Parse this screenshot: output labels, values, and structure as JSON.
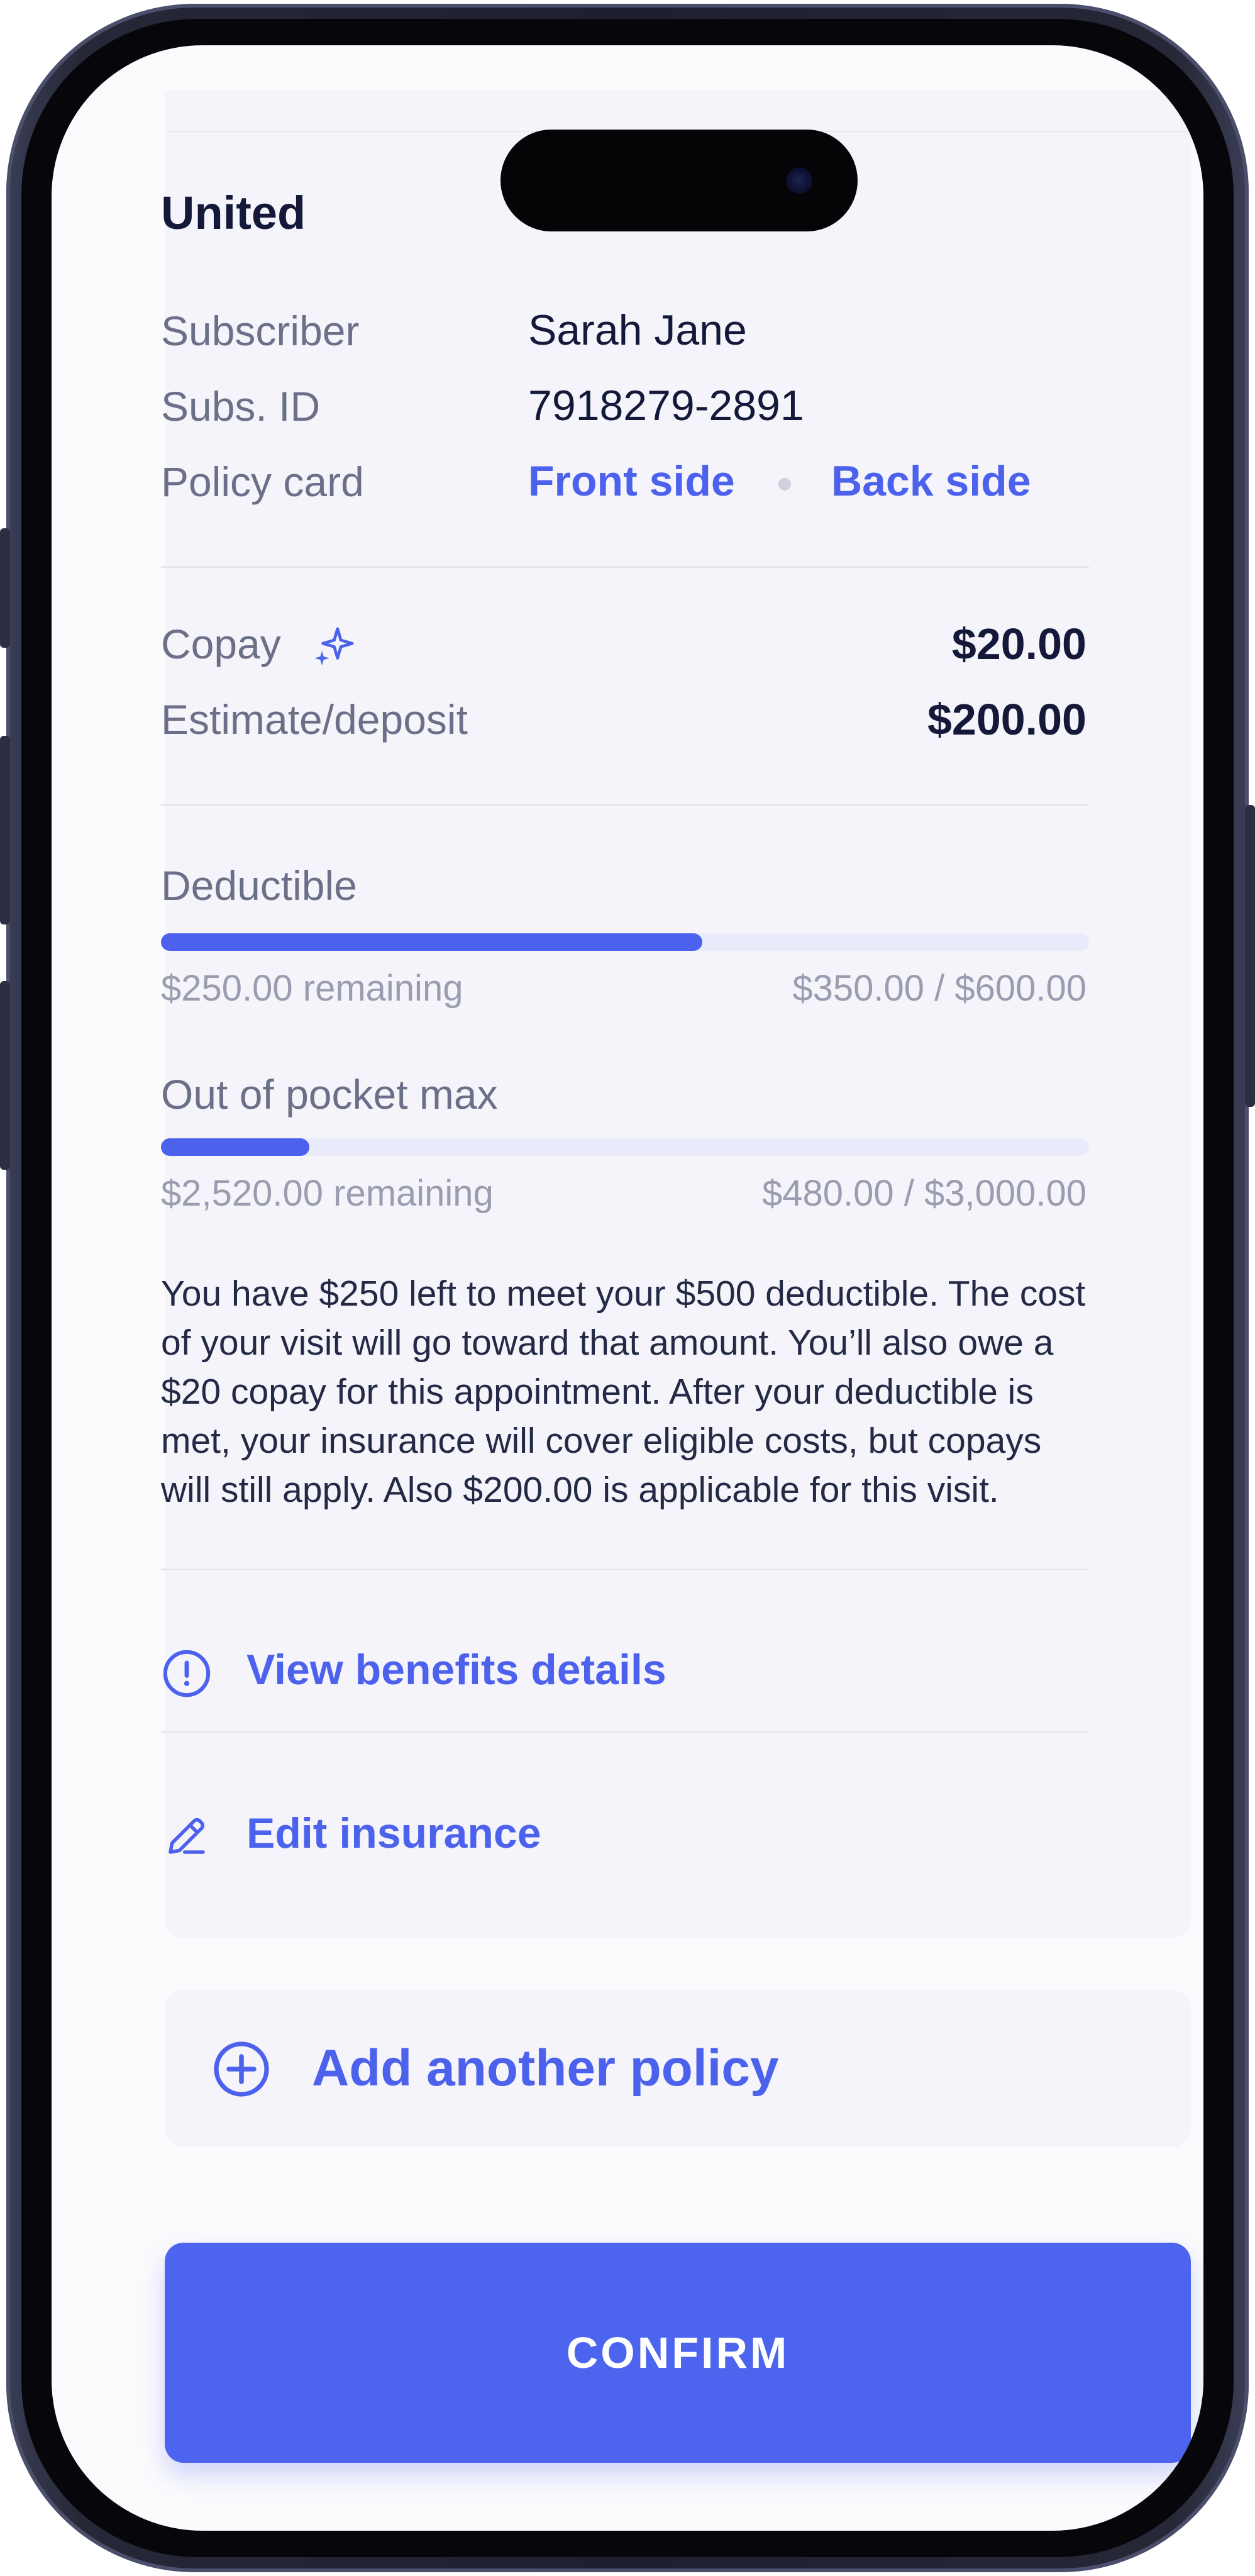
{
  "insurance": {
    "provider_name": "United",
    "subscriber_label": "Subscriber",
    "subscriber_value": "Sarah Jane",
    "subs_id_label": "Subs. ID",
    "subs_id_value": "7918279-2891",
    "policy_card_label": "Policy card",
    "front_side_label": "Front side",
    "back_side_label": "Back side",
    "copay_label": "Copay",
    "copay_value": "$20.00",
    "estimate_label": "Estimate/deposit",
    "estimate_value": "$200.00",
    "deductible": {
      "label": "Deductible",
      "remaining_text": "$250.00 remaining",
      "progress_text": "$350.00 / $600.00",
      "progress_fraction": 0.583
    },
    "out_of_pocket": {
      "label": "Out of pocket max",
      "remaining_text": "$2,520.00 remaining",
      "progress_text": "$480.00 / $3,000.00",
      "progress_fraction": 0.16
    },
    "explanation": "You have $250 left to meet your $500 deductible. The cost of your visit will go toward that amount. You’ll also owe a $20 copay for this appointment. After your deductible is met, your insurance will cover eligible costs, but copays will still apply. Also $200.00 is applicable for this visit.",
    "view_benefits_label": "View benefits details",
    "edit_insurance_label": "Edit insurance"
  },
  "add_policy_label": "Add another policy",
  "confirm_label": "CONFIRM",
  "colors": {
    "accent": "#4d62ec",
    "card_bg": "#f4f4fa",
    "text_dark": "#14193a",
    "text_muted": "#6b7088",
    "track": "#e9ebfa"
  },
  "icons": {
    "copay": "sparkles-icon",
    "view_benefits": "info-circle-icon",
    "edit_insurance": "pencil-icon",
    "add_policy": "plus-circle-icon"
  }
}
